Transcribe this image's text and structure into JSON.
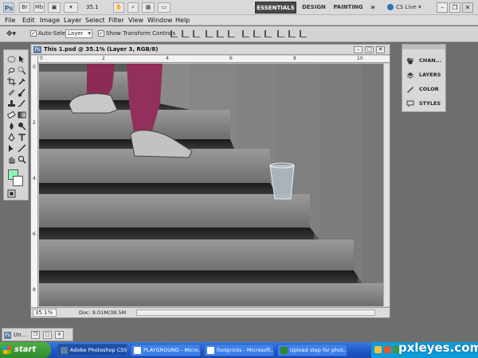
{
  "app": {
    "logo_text": "Ps",
    "zoom_readout": "35.1",
    "workspaces": [
      "ESSENTIALS",
      "DESIGN",
      "PAINTING"
    ],
    "more_glyph": "»",
    "cs_live": "CS Live"
  },
  "menu": [
    "File",
    "Edit",
    "Image",
    "Layer",
    "Select",
    "Filter",
    "View",
    "Window",
    "Help"
  ],
  "options": {
    "auto_select_label": "Auto-Select:",
    "auto_select_value": "Layer",
    "show_transform_label": "Show Transform Controls"
  },
  "document": {
    "title": "This 1.psd @ 35.1% (Layer 3, RGB/8)",
    "zoom": "35.1%",
    "doc_info": "Doc: 9.01M/38.5M",
    "ruler_top": [
      "0",
      "2",
      "4",
      "6",
      "8",
      "10"
    ],
    "ruler_left": [
      "0",
      "2",
      "4",
      "6",
      "8"
    ]
  },
  "panels": [
    {
      "label": "CHAN...",
      "icon": "channels-icon"
    },
    {
      "label": "LAYERS",
      "icon": "layers-icon"
    },
    {
      "label": "COLOR",
      "icon": "color-icon"
    },
    {
      "label": "STYLES",
      "icon": "styles-icon"
    }
  ],
  "minimized_doc": {
    "label": "Un..."
  },
  "colors": {
    "foreground": "#8ef5b0",
    "background": "#ffffff"
  },
  "taskbar": {
    "start_label": "start",
    "tasks": [
      {
        "label": "Adobe Photoshop CS5",
        "active": true
      },
      {
        "label": "PLAYGROUND - Micro...",
        "active": false
      },
      {
        "label": "footprints - Microsoft...",
        "active": false
      },
      {
        "label": "Upload step for phot...",
        "active": false
      }
    ]
  },
  "watermark": "pxleyes.com"
}
